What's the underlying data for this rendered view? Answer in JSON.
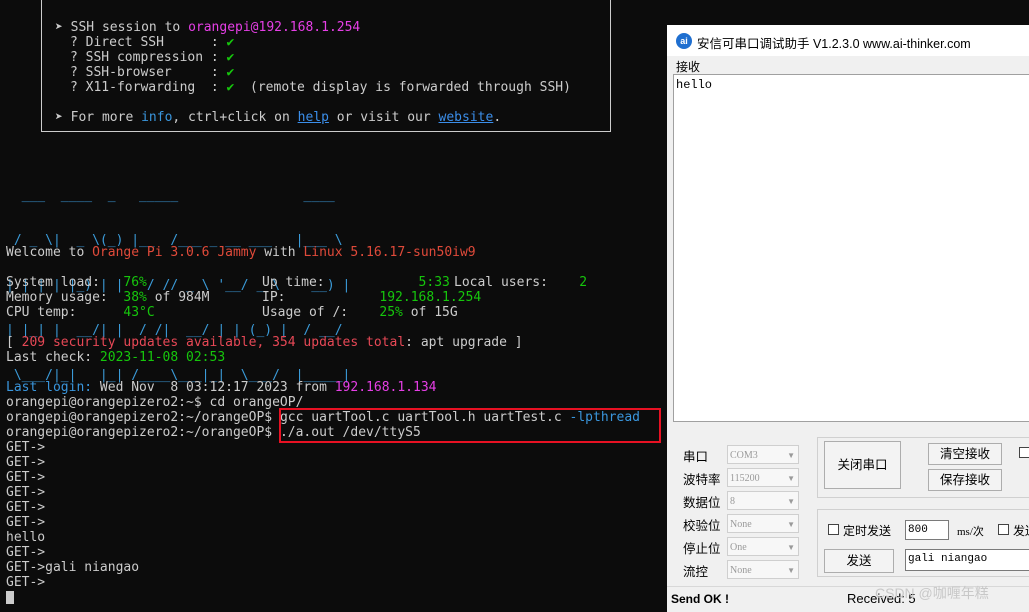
{
  "terminal": {
    "banner": {
      "ssh_session_prefix": "➤ SSH session to ",
      "ssh_target": "orangepi@192.168.1.254",
      "direct_ssh": "? Direct SSH      :",
      "compression": "? SSH compression :",
      "browser": "? SSH-browser     :",
      "x11": "? X11-forwarding  :",
      "check": "✔",
      "x11_note": "  (remote display is forwarded through SSH)",
      "more_prefix": "➤ For more ",
      "info_link": "info",
      "more_mid": ", ctrl+click on ",
      "help_link": "help",
      "more_mid2": " or visit our ",
      "website_link": "website",
      "more_end": "."
    },
    "logo": [
      "  ___  ____  _   _____                ____",
      " / _ \\|  _ \\(_) |__  /___ _ __ ___   |___ \\",
      "| | | | |_) | |   / // _ \\ '__/ _ \\    __) |",
      "| |_| |  __/| |  / /|  __/ | | (_) |  / __/",
      " \\___/|_|   |_| /____\\___|_|  \\___/  |_____|"
    ],
    "welcome_prefix": "Welcome to ",
    "os_name": "Orange Pi 3.0.6 Jammy",
    "welcome_mid": " with ",
    "kernel": "Linux 5.16.17-sun50iw9",
    "stats": {
      "system_load_label": "System load:   ",
      "system_load": "76%",
      "uptime_label": "Up time:       ",
      "uptime": "5:33",
      "local_users_label": "Local users:  ",
      "local_users": "2",
      "memory_label": "Memory usage:  ",
      "memory_pct": "38%",
      "memory_of": " of 984M",
      "ip_label": "IP:            ",
      "ip": "192.168.1.254",
      "cpu_label": "CPU temp:      ",
      "cpu_temp": "43°C",
      "usage_label": "Usage of /:    ",
      "usage_pct": "25%",
      "usage_of": " of 15G"
    },
    "updates_open": "[ ",
    "updates_text": "209 security updates available, 354 updates total",
    "updates_cmd": ": apt upgrade ]",
    "last_check_label": "Last check: ",
    "last_check": "2023-11-08 02:53",
    "last_login_label": "Last login:",
    "last_login_value": " Wed Nov  8 03:12:17 2023 from ",
    "last_login_ip": "192.168.1.134",
    "prompt1": "orangepi@orangepizero2:~$ cd orangeOP/",
    "prompt2": "orangepi@orangepizero2:~/orangeOP$ ",
    "cmd2_a": "gcc uartTool.c uartTool.h uartTest.c ",
    "cmd2_b": "-lpthread",
    "prompt3": "orangepi@orangepizero2:~/orangeOP$ ",
    "cmd3": "./a.out /dev/ttyS5",
    "output": [
      "GET->",
      "GET->",
      "GET->",
      "GET->",
      "GET->",
      "GET->",
      "hello",
      "GET->",
      "GET->gali niangao",
      "GET->"
    ]
  },
  "serial": {
    "icon_text": "ai",
    "title": "安信可串口调试助手 V1.2.3.0    www.ai-thinker.com",
    "receive_label": "接收",
    "receive_text": "hello",
    "port_label": "串口",
    "port_value": "COM3",
    "baud_label": "波特率",
    "baud_value": "115200",
    "databits_label": "数据位",
    "databits_value": "8",
    "parity_label": "校验位",
    "parity_value": "None",
    "stopbits_label": "停止位",
    "stopbits_value": "One",
    "flow_label": "流控",
    "flow_value": "None",
    "close_port": "关闭串口",
    "clear_receive": "清空接收",
    "save_receive": "保存接收",
    "timed_send": "定时发送",
    "interval_value": "800",
    "interval_unit": "ms/次",
    "send_newline": "发送",
    "send_button": "发送",
    "send_input": "gali niangao",
    "status_send": "Send OK !",
    "status_received": "Received: 5",
    "watermark": "CSDN @咖喱年糕"
  }
}
